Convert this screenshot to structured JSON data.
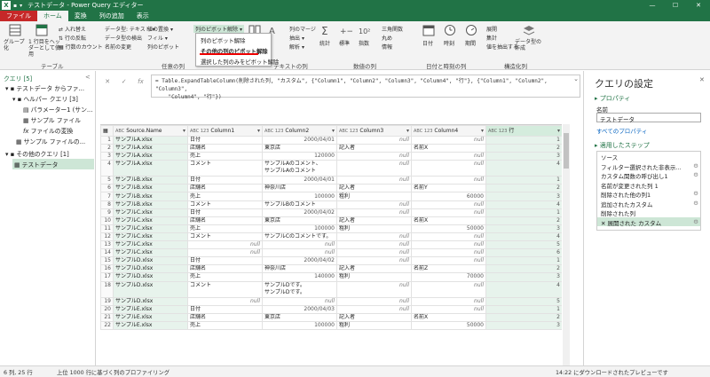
{
  "window": {
    "title": "テストデータ - Power Query エディター",
    "minimize": "—",
    "maximize": "☐",
    "close": "✕"
  },
  "tabs": [
    "ファイル",
    "ホーム",
    "変換",
    "列の追加",
    "表示"
  ],
  "ribbon": {
    "group_table": "テーブル",
    "group_anycol": "任意の列",
    "group_textcol": "テキストの列",
    "group_numcol": "数値の列",
    "group_datetime": "日付と時刻の列",
    "group_struct": "構造化列",
    "group_by": "グループ化",
    "use_first_row": "1 行目をヘッダーとして使用",
    "transpose": "入れ替え",
    "reverse_rows": "行の反転",
    "count_rows": "行数のカウント",
    "data_type": "データ型: テキスト",
    "detect_type": "データ型の検出",
    "rename": "名前の変更",
    "replace_values": "値の置換",
    "fill": "フィル",
    "pivot_col": "列のピボット",
    "unpivot": "列のピボット解除",
    "merge_cols": "列のマージ",
    "extract": "抽出",
    "parse": "解析",
    "statistics": "統計",
    "standard": "標準",
    "scientific": "指数",
    "trig": "三角関数",
    "rounding": "丸め",
    "info": "情報",
    "date": "日付",
    "time": "時刻",
    "duration": "期間",
    "expand": "展開",
    "aggregate": "集計",
    "extract_values": "値を抽出する",
    "data_type_create": "データ型の作成",
    "chevron": "▾"
  },
  "unpivot_menu": {
    "items": [
      "列のピボット解除",
      "その他の列のピボット解除",
      "選択した列のみをピボット解除"
    ]
  },
  "queries_pane": {
    "header": "クエリ [5]",
    "collapse": "<",
    "items": [
      {
        "label": "テストデータ からファ...",
        "icon": "▾"
      },
      {
        "label": "ヘルパー クエリ [3]",
        "icon": "▾"
      },
      {
        "label": "パラメーター1 (サン...",
        "icon": ""
      },
      {
        "label": "サンプル ファイル",
        "icon": ""
      },
      {
        "label": "ファイルの変換",
        "icon": "fx"
      },
      {
        "label": "サンプル ファイルの...",
        "icon": ""
      },
      {
        "label": "その他のクエリ [1]",
        "icon": "▾"
      },
      {
        "label": "テストデータ",
        "icon": ""
      }
    ]
  },
  "formula": {
    "cancel": "✕",
    "commit": "✓",
    "fx": "fx",
    "text": "= Table.ExpandTableColumn(削除された列, \"カスタム\", {\"Column1\", \"Column2\", \"Column3\", \"Column4\", \"行\"}, {\"Column1\", \"Column2\", \"Column3\",\n    \"Column4\", \"行\"})",
    "expand_toggle": "⌄"
  },
  "grid": {
    "headers": [
      {
        "type": "ABC",
        "name": "Source.Name"
      },
      {
        "type": "ABC 123",
        "name": "Column1"
      },
      {
        "type": "ABC 123",
        "name": "Column2"
      },
      {
        "type": "ABC 123",
        "name": "Column3"
      },
      {
        "type": "ABC 123",
        "name": "Column4"
      },
      {
        "type": "ABC 123",
        "name": "行"
      }
    ],
    "rows": [
      [
        "1",
        "サンプルA.xlsx",
        "日付",
        "2000/04/01",
        "null",
        "null",
        "1"
      ],
      [
        "2",
        "サンプルA.xlsx",
        "店舗名",
        "東京店",
        "記入者",
        "名前X",
        "2"
      ],
      [
        "3",
        "サンプルA.xlsx",
        "売上",
        "120000",
        "null",
        "null",
        "3"
      ],
      [
        "4",
        "サンプルA.xlsx",
        "コメント",
        "サンプルAのコメント、\nサンプルAのコメント",
        "null",
        "null",
        "4"
      ],
      [
        "5",
        "サンプルB.xlsx",
        "日付",
        "2000/04/01",
        "null",
        "null",
        "1"
      ],
      [
        "6",
        "サンプルB.xlsx",
        "店舗名",
        "神奈川店",
        "記入者",
        "名前Y",
        "2"
      ],
      [
        "7",
        "サンプルB.xlsx",
        "売上",
        "100000",
        "粗利",
        "60000",
        "3"
      ],
      [
        "8",
        "サンプルB.xlsx",
        "コメント",
        "サンプルBのコメント",
        "null",
        "null",
        "4"
      ],
      [
        "9",
        "サンプルC.xlsx",
        "日付",
        "2000/04/02",
        "null",
        "null",
        "1"
      ],
      [
        "10",
        "サンプルC.xlsx",
        "店舗名",
        "東京店",
        "記入者",
        "名前X",
        "2"
      ],
      [
        "11",
        "サンプルC.xlsx",
        "売上",
        "100000",
        "粗利",
        "50000",
        "3"
      ],
      [
        "12",
        "サンプルC.xlsx",
        "コメント",
        "サンプルCのコメントです。",
        "null",
        "null",
        "4"
      ],
      [
        "13",
        "サンプルC.xlsx",
        "null",
        "null",
        "null",
        "null",
        "5"
      ],
      [
        "14",
        "サンプルC.xlsx",
        "null",
        "null",
        "null",
        "null",
        "6"
      ],
      [
        "15",
        "サンプルD.xlsx",
        "日付",
        "2000/04/02",
        "null",
        "null",
        "1"
      ],
      [
        "16",
        "サンプルD.xlsx",
        "店舗名",
        "神奈川店",
        "記入者",
        "名前Z",
        "2"
      ],
      [
        "17",
        "サンプルD.xlsx",
        "売上",
        "140000",
        "粗利",
        "70000",
        "3"
      ],
      [
        "18",
        "サンプルD.xlsx",
        "コメント",
        "サンプルDです。\nサンプルDです。",
        "null",
        "null",
        "4"
      ],
      [
        "19",
        "サンプルD.xlsx",
        "null",
        "null",
        "null",
        "null",
        "5"
      ],
      [
        "20",
        "サンプルE.xlsx",
        "日付",
        "2000/04/03",
        "null",
        "null",
        "1"
      ],
      [
        "21",
        "サンプルE.xlsx",
        "店舗名",
        "東京店",
        "記入者",
        "名前X",
        "2"
      ],
      [
        "22",
        "サンプルE.xlsx",
        "売上",
        "100000",
        "粗利",
        "50000",
        "3"
      ]
    ]
  },
  "settings": {
    "title": "クエリの設定",
    "close": "✕",
    "properties": "▸ プロパティ",
    "name_label": "名前",
    "name_value": "テストデータ",
    "all_props": "すべてのプロパティ",
    "applied_steps": "▸ 適用したステップ",
    "steps": [
      "ソース",
      "フィルター選択された非表示...",
      "カスタム関数の呼び出し1",
      "名前が変更された列 1",
      "削除された他の列1",
      "追加されたカスタム",
      "削除された列",
      "展開された カスタム"
    ]
  },
  "status": {
    "left": "6 列, 25 行",
    "middle": "上位 1000 行に基づく列のプロファイリング",
    "right": "14:22 にダウンロードされたプレビューです"
  },
  "colors": {
    "brand": "#217346",
    "file_tab": "#c62828",
    "highlight": "#e00000"
  }
}
